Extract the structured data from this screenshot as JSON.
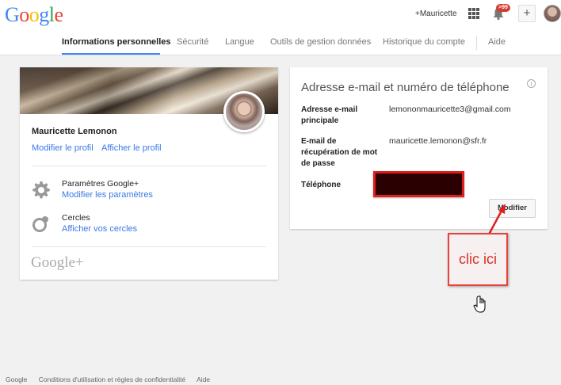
{
  "header": {
    "logo_letters": [
      "G",
      "o",
      "o",
      "g",
      "l",
      "e"
    ],
    "plus_name": "+Mauricette",
    "notification_count": ">99",
    "share_label": "+"
  },
  "tabs": [
    {
      "label": "Informations personnelles",
      "active": true
    },
    {
      "label": "Sécurité"
    },
    {
      "label": "Langue"
    },
    {
      "label": "Outils de gestion données"
    },
    {
      "label": "Historique du compte"
    },
    {
      "label": "Aide"
    }
  ],
  "profile": {
    "name": "Mauricette Lemonon",
    "edit_profile": "Modifier le profil",
    "view_profile": "Afficher le profil",
    "settings_title": "Paramètres Google+",
    "settings_link": "Modifier les paramètres",
    "circles_title": "Cercles",
    "circles_link": "Afficher vos cercles",
    "gplus_logo": "Google+"
  },
  "contact": {
    "title": "Adresse e-mail et numéro de téléphone",
    "primary_email_label": "Adresse e-mail principale",
    "primary_email_value": "lemononmauricette3@gmail.com",
    "recovery_email_label": "E-mail de récupération de mot de passe",
    "recovery_email_value": "mauricette.lemonon@sfr.fr",
    "phone_label": "Téléphone",
    "modify_button": "Modifier"
  },
  "annotation": {
    "text": "clic ici",
    "color": "#e8423b"
  },
  "footer": {
    "google": "Google",
    "terms": "Conditions d'utilisation et règles de confidentialité",
    "help": "Aide"
  }
}
